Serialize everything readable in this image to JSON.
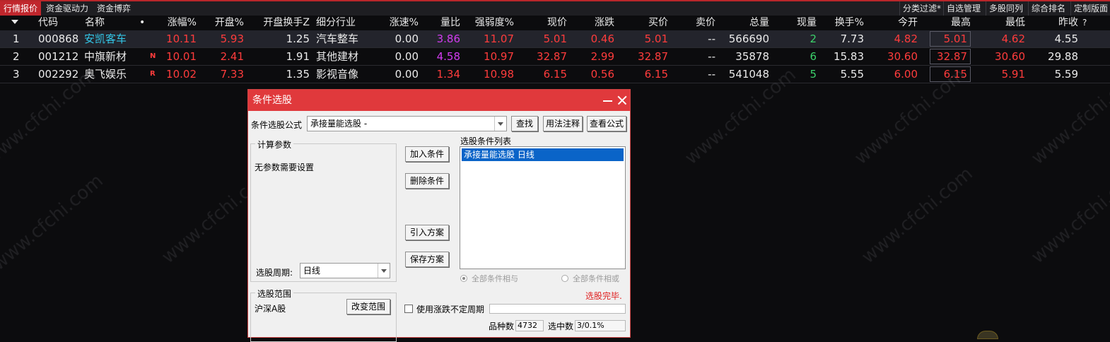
{
  "topbar": {
    "tabs": [
      "行情报价",
      "资金驱动力",
      "资金博弈"
    ],
    "right_tabs": [
      "分类过滤*",
      "自选管理",
      "多股同列",
      "综合排名",
      "定制版面"
    ]
  },
  "header": {
    "sort_icon": "triangle-down-icon",
    "columns": [
      "代码",
      "名称",
      "•",
      "涨幅%",
      "开盘%",
      "开盘换手Z",
      "细分行业",
      "涨速%",
      "量比",
      "强弱度%",
      "现价",
      "涨跌",
      "买价",
      "卖价",
      "总量",
      "现量",
      "换手%",
      "今开",
      "最高",
      "最低",
      "昨收",
      "?"
    ]
  },
  "rows": [
    {
      "idx": "1",
      "code": "000868",
      "name": "安凯客车",
      "flag": "",
      "chg_pct": "10.11",
      "open_pct": "5.93",
      "open_turnover": "1.25",
      "industry": "汽车整车",
      "speed": "0.00",
      "vol_ratio": "3.86",
      "strength": "11.07",
      "price": "5.01",
      "change": "0.46",
      "bid": "5.01",
      "ask": "--",
      "volume": "566690",
      "cur_vol": "2",
      "turnover": "7.73",
      "open": "4.82",
      "high": "5.01",
      "low": "4.62",
      "prev_close": "4.55"
    },
    {
      "idx": "2",
      "code": "001212",
      "name": "中旗新材",
      "flag": "N",
      "chg_pct": "10.01",
      "open_pct": "2.41",
      "open_turnover": "1.91",
      "industry": "其他建材",
      "speed": "0.00",
      "vol_ratio": "4.58",
      "strength": "10.97",
      "price": "32.87",
      "change": "2.99",
      "bid": "32.87",
      "ask": "--",
      "volume": "35878",
      "cur_vol": "6",
      "turnover": "15.83",
      "open": "30.60",
      "high": "32.87",
      "low": "30.60",
      "prev_close": "29.88"
    },
    {
      "idx": "3",
      "code": "002292",
      "name": "奥飞娱乐",
      "flag": "R",
      "chg_pct": "10.02",
      "open_pct": "7.33",
      "open_turnover": "1.35",
      "industry": "影视音像",
      "speed": "0.00",
      "vol_ratio": "1.34",
      "strength": "10.98",
      "price": "6.15",
      "change": "0.56",
      "bid": "6.15",
      "ask": "--",
      "volume": "541048",
      "cur_vol": "5",
      "turnover": "5.55",
      "open": "6.00",
      "high": "6.15",
      "low": "5.91",
      "prev_close": "5.59"
    }
  ],
  "watermark": "www.cfchi.com",
  "dialog": {
    "title": "条件选股",
    "formula_label": "条件选股公式",
    "formula_value": "承接量能选股 -",
    "btn_find": "查找",
    "btn_usage": "用法注释",
    "btn_view": "查看公式",
    "params_group": "计算参数",
    "params_text": "无参数需要设置",
    "period_label": "选股周期:",
    "period_value": "日线",
    "btn_add": "加入条件",
    "btn_delete": "删除条件",
    "btn_import": "引入方案",
    "btn_save": "保存方案",
    "list_title": "选股条件列表",
    "list_items": [
      "承接量能选股  日线"
    ],
    "radio_and": "全部条件相与",
    "radio_or": "全部条件相或",
    "done_text": "选股完毕.",
    "scope_group": "选股范围",
    "scope_value": "沪深A股",
    "btn_change_scope": "改变范围",
    "use_period_label": "使用涨跌不定周期",
    "count_label": "品种数",
    "count_value": "4732",
    "selected_label": "选中数",
    "selected_value": "3/0.1%"
  }
}
